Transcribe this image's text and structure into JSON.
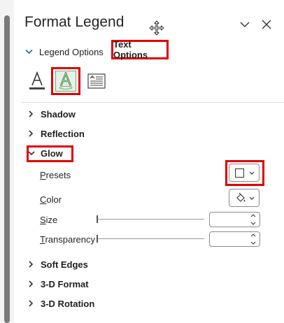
{
  "pane": {
    "title": "Format Legend"
  },
  "tabs": {
    "legend_options": "Legend Options",
    "text_options": "Text Options"
  },
  "sections": [
    {
      "label": "Shadow",
      "expanded": false
    },
    {
      "label": "Reflection",
      "expanded": false
    },
    {
      "label": "Glow",
      "expanded": true
    },
    {
      "label": "Soft Edges",
      "expanded": false
    },
    {
      "label": "3-D Format",
      "expanded": false
    },
    {
      "label": "3-D Rotation",
      "expanded": false
    }
  ],
  "glow": {
    "presets": {
      "key": "P",
      "rest": "resets"
    },
    "color": {
      "key": "C",
      "rest": "olor"
    },
    "size": {
      "key": "S",
      "rest": "ize",
      "value": ""
    },
    "transparency": {
      "key": "T",
      "rest": "ransparency",
      "value": ""
    }
  },
  "colors": {
    "highlight": "#e00000",
    "text_fill_green": "#2e7d32"
  }
}
